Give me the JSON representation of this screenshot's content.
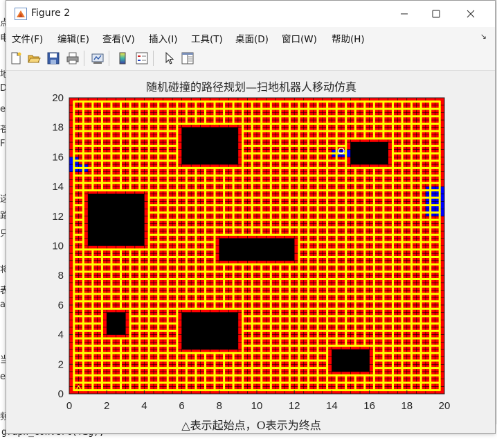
{
  "background": {
    "left_fragments": [
      "点",
      "电",
      "地",
      "D",
      "ee",
      "苍",
      "F",
      "这",
      "路",
      "只",
      "将",
      "表",
      "a",
      "当",
      "e",
      "频"
    ],
    "bottom_text": "graph_convert(fig);"
  },
  "window": {
    "title": "Figure 2",
    "icon": "matlab-figure-icon",
    "controls": {
      "minimize": "minimize-icon",
      "maximize": "maximize-icon",
      "close": "close-icon"
    }
  },
  "menubar": {
    "items": [
      "文件(F)",
      "编辑(E)",
      "查看(V)",
      "插入(I)",
      "工具(T)",
      "桌面(D)",
      "窗口(W)",
      "帮助(H)"
    ],
    "overflow_icon": "dock-arrow-icon"
  },
  "toolbar": {
    "buttons": [
      "new-figure-icon",
      "open-file-icon",
      "save-icon",
      "print-icon",
      "link-plot-icon",
      "insert-colorbar-icon",
      "insert-legend-icon",
      "edit-plot-arrow-icon",
      "property-inspector-icon"
    ]
  },
  "chart_data": {
    "type": "heatmap",
    "title": "随机碰撞的路径规划—扫地机器人移动仿真",
    "xlabel": "△表示起始点，O表示为终点",
    "ylabel": "",
    "xlim": [
      0,
      20
    ],
    "ylim": [
      0,
      20
    ],
    "xticks": [
      0,
      2,
      4,
      6,
      8,
      10,
      12,
      14,
      16,
      18,
      20
    ],
    "yticks": [
      0,
      2,
      4,
      6,
      8,
      10,
      12,
      14,
      16,
      18,
      20
    ],
    "grid_cell_size": 0.5,
    "colors": {
      "free": "#ff0000",
      "obstacle": "#000000",
      "marked": "#0000ff",
      "path": "#ffff00",
      "gridline": "#000000"
    },
    "obstacles": [
      {
        "x": [
          6,
          9
        ],
        "y": [
          15.5,
          18
        ]
      },
      {
        "x": [
          1,
          4
        ],
        "y": [
          10,
          13.5
        ]
      },
      {
        "x": [
          8,
          12
        ],
        "y": [
          9,
          10.5
        ]
      },
      {
        "x": [
          6,
          9
        ],
        "y": [
          3,
          5.5
        ]
      },
      {
        "x": [
          2,
          3
        ],
        "y": [
          4,
          5.5
        ]
      },
      {
        "x": [
          14,
          16
        ],
        "y": [
          1.5,
          3
        ]
      },
      {
        "x": [
          15,
          17
        ],
        "y": [
          15.5,
          17
        ]
      }
    ],
    "marked_cells": [
      {
        "x": [
          0,
          1
        ],
        "y": [
          15,
          15.5
        ]
      },
      {
        "x": [
          0,
          0.5
        ],
        "y": [
          15.5,
          16
        ]
      },
      {
        "x": [
          14,
          15
        ],
        "y": [
          16,
          16.5
        ]
      },
      {
        "x": [
          19,
          20
        ],
        "y": [
          12,
          14
        ]
      }
    ],
    "start": {
      "x": 0.5,
      "y": 0.5,
      "marker": "triangle"
    },
    "goal": {
      "x": 14.5,
      "y": 16.5,
      "marker": "circle"
    }
  }
}
